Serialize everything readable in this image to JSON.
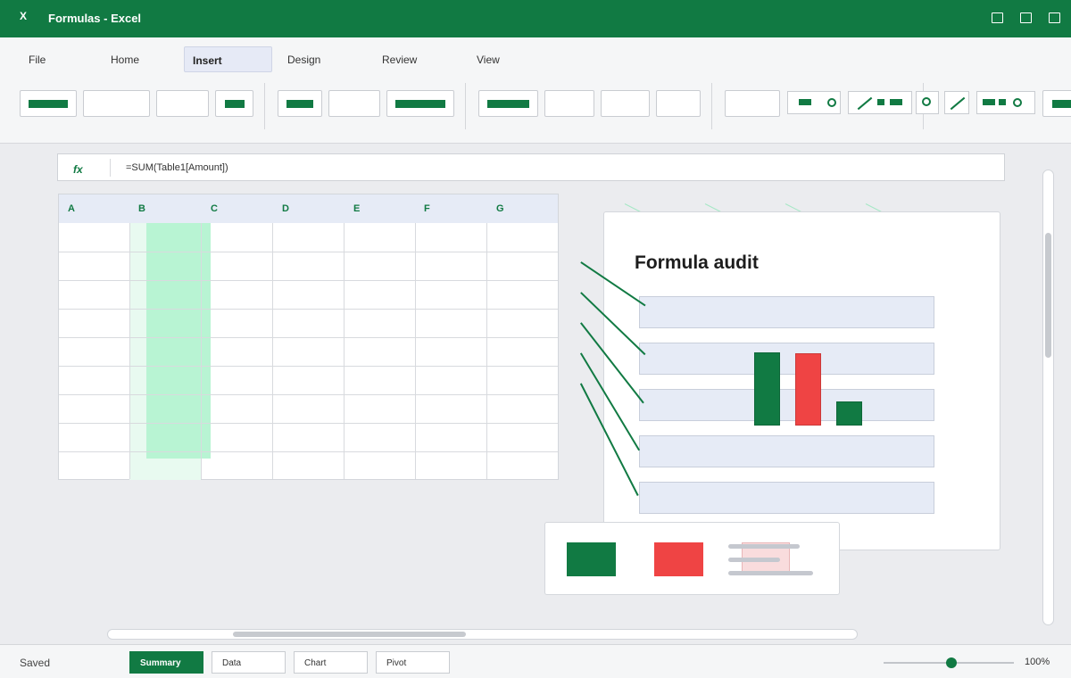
{
  "window": {
    "title": "Formulas - Excel",
    "app_icon": "X"
  },
  "ribbon": {
    "tabs": [
      {
        "label": "File",
        "active": false
      },
      {
        "label": "Home",
        "active": false
      },
      {
        "label": "Insert",
        "active": true
      },
      {
        "label": "Design",
        "active": false
      },
      {
        "label": "Review",
        "active": false
      },
      {
        "label": "View",
        "active": false
      }
    ]
  },
  "formula_bar": {
    "fx_label": "fx",
    "formula": "=SUM(Table1[Amount])"
  },
  "grid": {
    "columns": [
      "A",
      "B",
      "C",
      "D",
      "E",
      "F",
      "G"
    ]
  },
  "audit_panel": {
    "title": "Formula audit"
  },
  "status_bar": {
    "status": "Saved",
    "sheets": [
      {
        "label": "Summary",
        "active": true
      },
      {
        "label": "Data",
        "active": false
      },
      {
        "label": "Chart",
        "active": false
      },
      {
        "label": "Pivot",
        "active": false
      }
    ],
    "zoom": "100%"
  },
  "colors": {
    "accent": "#117a43",
    "danger": "#ef4444",
    "selection": "#b8f4d3",
    "row_fill": "#e6ebf6"
  }
}
